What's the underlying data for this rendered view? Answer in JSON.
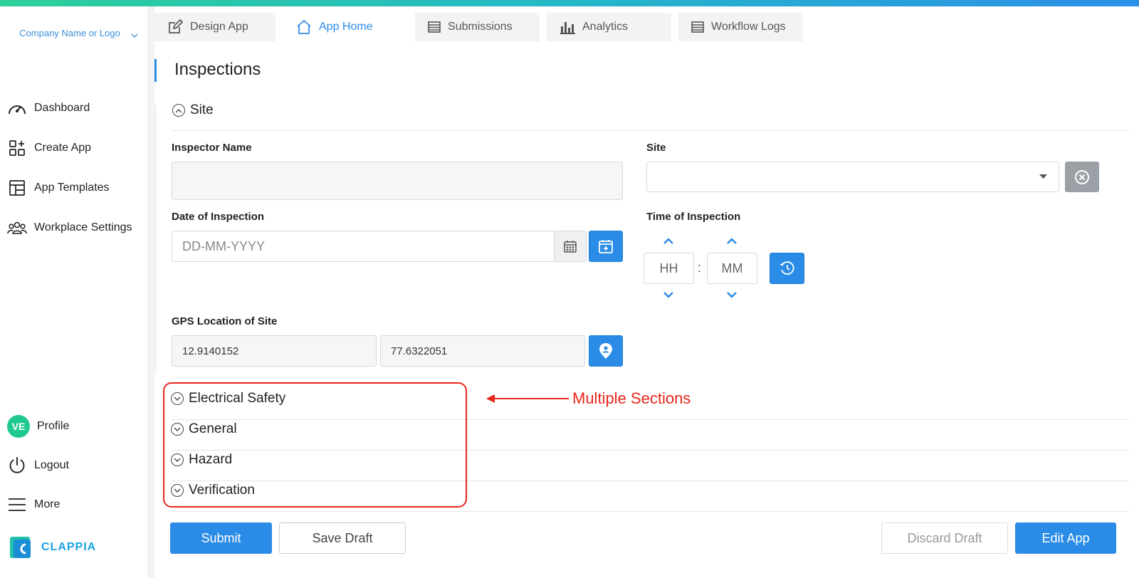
{
  "company": {
    "name": "Company Name or Logo"
  },
  "sidebar": {
    "items": [
      {
        "label": "Dashboard",
        "icon": "dashboard-icon"
      },
      {
        "label": "Create App",
        "icon": "create-app-icon"
      },
      {
        "label": "App Templates",
        "icon": "templates-icon"
      },
      {
        "label": "Workplace Settings",
        "icon": "users-icon"
      }
    ],
    "bottom": [
      {
        "label": "Profile",
        "avatar": "VE"
      },
      {
        "label": "Logout",
        "icon": "power-icon"
      },
      {
        "label": "More",
        "icon": "menu-icon"
      }
    ],
    "brand": "CLAPPIA"
  },
  "tabs": [
    {
      "label": "Design App",
      "icon": "edit-icon",
      "active": false
    },
    {
      "label": "App Home",
      "icon": "home-icon",
      "active": true
    },
    {
      "label": "Submissions",
      "icon": "list-icon",
      "active": false
    },
    {
      "label": "Analytics",
      "icon": "bar-chart-icon",
      "active": false
    },
    {
      "label": "Workflow Logs",
      "icon": "list-icon",
      "active": false
    }
  ],
  "page": {
    "title": "Inspections"
  },
  "site_section": {
    "title": "Site",
    "fields": {
      "inspector_name": {
        "label": "Inspector Name",
        "value": ""
      },
      "site": {
        "label": "Site",
        "value": ""
      },
      "date": {
        "label": "Date of Inspection",
        "placeholder": "DD-MM-YYYY"
      },
      "time": {
        "label": "Time of Inspection",
        "hh": "HH",
        "mm": "MM",
        "separator": ":"
      },
      "gps": {
        "label": "GPS Location of Site",
        "lat": "12.9140152",
        "lng": "77.6322051"
      }
    }
  },
  "sections": [
    {
      "title": "Electrical Safety"
    },
    {
      "title": "General"
    },
    {
      "title": "Hazard"
    },
    {
      "title": "Verification"
    }
  ],
  "annotation": {
    "text": "Multiple Sections",
    "color": "#e8261b"
  },
  "footer": {
    "submit": "Submit",
    "save_draft": "Save Draft",
    "discard_draft": "Discard Draft",
    "edit_app": "Edit App"
  },
  "colors": {
    "accent": "#2a8ce6",
    "avatar": "#1fc98f",
    "brand": "#1aa3e0"
  }
}
